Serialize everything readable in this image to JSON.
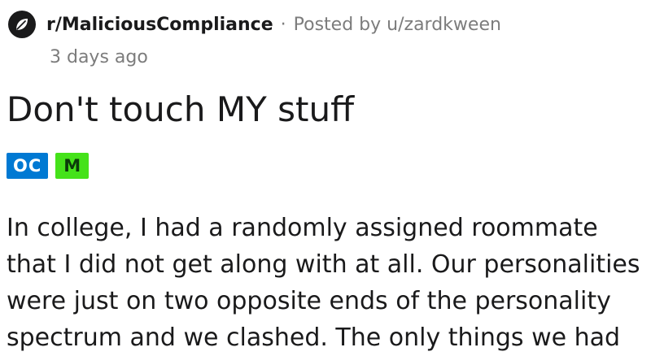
{
  "post": {
    "subreddit": "r/MaliciousCompliance",
    "separator": "·",
    "posted_by_prefix": "Posted by",
    "username": "u/zardkween",
    "timestamp": "3 days ago",
    "title": "Don't touch MY stuff",
    "flairs": [
      {
        "label": "OC",
        "color": "#0079d3"
      },
      {
        "label": "M",
        "color": "#45e21a"
      }
    ],
    "body": "In college, I had a randomly assigned roommate that I did not get along with at all. Our personalities were just on two opposite ends of the personality spectrum and we clashed. The only things we had"
  },
  "icons": {
    "subreddit_icon": "leaf-icon"
  },
  "colors": {
    "meta_text": "#7c7c7c",
    "text": "#1a1a1b"
  }
}
